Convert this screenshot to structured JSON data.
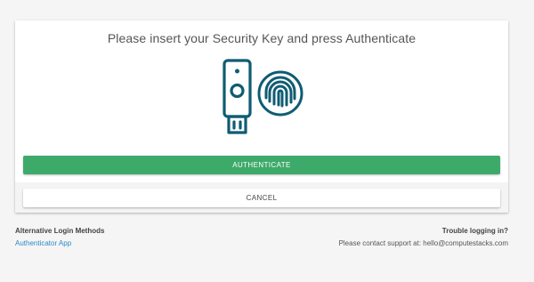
{
  "card": {
    "title": "Please insert your Security Key and press Authenticate",
    "illustration": {
      "icons": [
        "usb-security-key-icon",
        "fingerprint-icon"
      ],
      "color": "#0f5c73"
    },
    "authenticate_label": "AUTHENTICATE",
    "cancel_label": "CANCEL"
  },
  "alternative": {
    "heading": "Alternative Login Methods",
    "link_label": "Authenticator App"
  },
  "support": {
    "heading": "Trouble logging in?",
    "text": "Please contact support at: hello@computestacks.com"
  },
  "colors": {
    "primary": "#3daa6a",
    "link": "#2a8ac8",
    "icon": "#0f5c73",
    "background": "#f5f5f5"
  }
}
